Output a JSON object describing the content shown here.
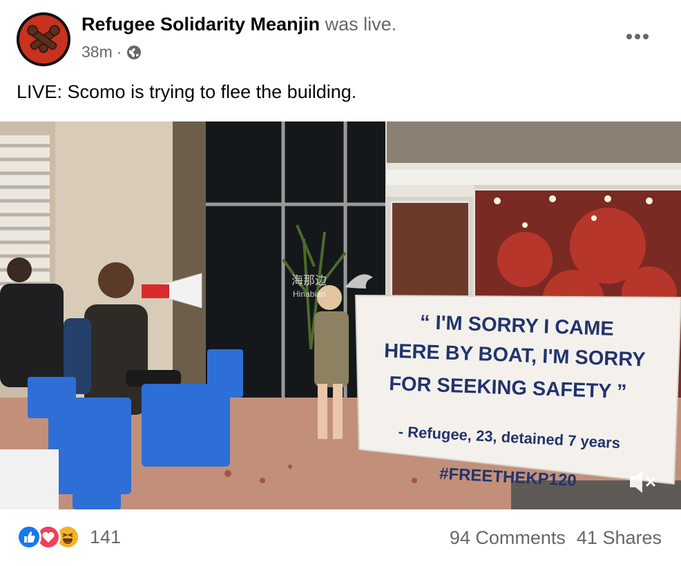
{
  "post": {
    "author": "Refugee Solidarity Meanjin",
    "action": "was live.",
    "time": "38m",
    "separator": "·",
    "privacy_icon": "globe-icon",
    "text": "LIVE: Scomo is trying to flee the building."
  },
  "video": {
    "banner_line1": "“ I'M SORRY I CAME",
    "banner_line2": "HERE BY BOAT, I'M SORRY",
    "banner_line3": "FOR SEEKING SAFETY ”",
    "banner_line4": "- Refugee, 23, detained 7 years",
    "banner_line5": "#FREETHEKP120",
    "watermark_line1": "海那边",
    "watermark_line2": "Hinabian",
    "mute_icon": "speaker-muted-icon"
  },
  "footer": {
    "reaction_icons": [
      "like-icon",
      "love-icon",
      "haha-icon"
    ],
    "reaction_count": "141",
    "comments": "94 Comments",
    "shares": "41 Shares"
  },
  "colors": {
    "avatar_red": "#c8321f",
    "like_blue": "#1877f2",
    "love_red": "#f33e58",
    "haha_yellow": "#f7b125",
    "secondary_text": "#65676b",
    "banner_ink": "#22346e"
  }
}
